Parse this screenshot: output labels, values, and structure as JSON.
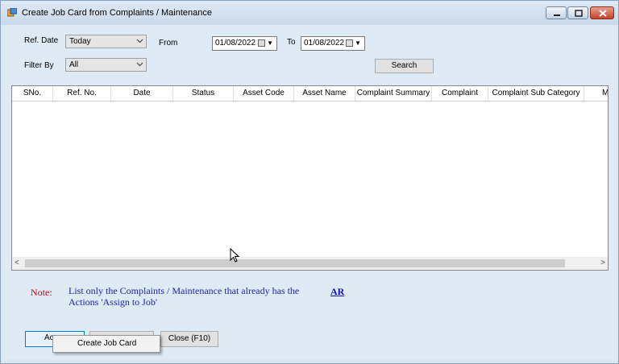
{
  "window": {
    "title": "Create Job Card from Complaints / Maintenance"
  },
  "filters": {
    "ref_date_label": "Ref. Date",
    "ref_date_value": "Today",
    "from_label": "From",
    "from_date": "01/08/2022",
    "to_label": "To",
    "to_date": "01/08/2022",
    "filter_by_label": "Filter By",
    "filter_by_value": "All",
    "search_label": "Search"
  },
  "grid": {
    "columns": [
      "SNo.",
      "Ref. No.",
      "Date",
      "Status",
      "Asset Code",
      "Asset Name",
      "Complaint Summary",
      "Complaint",
      "Complaint Sub Category",
      "M"
    ],
    "rows": []
  },
  "note": {
    "label": "Note:",
    "text": "List only the Complaints / Maintenance that already has the Actions 'Assign to Job'",
    "link": "AR"
  },
  "buttons": {
    "action_label": "Ac",
    "close_label": "Close (F10)"
  },
  "context_menu": {
    "items": [
      "Create Job Card"
    ]
  },
  "colors": {
    "note_label": "#d40000",
    "note_text": "#2020c0",
    "close_button": "#c4422b"
  }
}
